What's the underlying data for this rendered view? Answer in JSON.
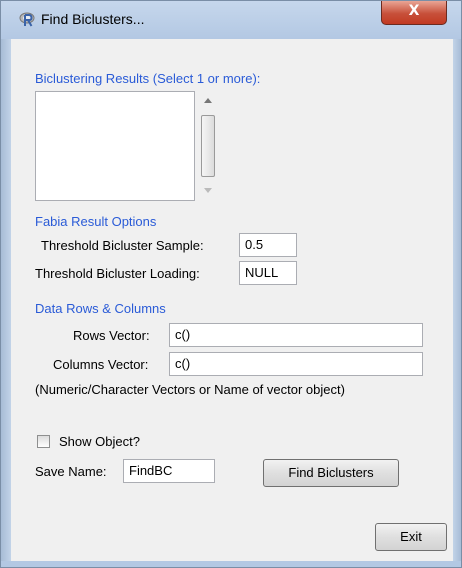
{
  "window": {
    "title": "Find Biclusters...",
    "close_label": "X"
  },
  "results": {
    "section_label": "Biclustering Results (Select 1 or more):",
    "items": []
  },
  "fabia": {
    "section_label": "Fabia Result Options",
    "thresh_sample_label": "Threshold Bicluster Sample:",
    "thresh_sample_value": "0.5",
    "thresh_loading_label": "Threshold Bicluster Loading:",
    "thresh_loading_value": "NULL"
  },
  "data": {
    "section_label": "Data Rows & Columns",
    "rows_label": "Rows Vector:",
    "rows_value": "c()",
    "cols_label": "Columns Vector:",
    "cols_value": "c()",
    "hint": "(Numeric/Character Vectors or Name of vector object)"
  },
  "options": {
    "show_object_label": "Show Object?",
    "show_object_checked": false,
    "save_name_label": "Save Name:",
    "save_name_value": "FindBC",
    "find_button": "Find Biclusters",
    "exit_button": "Exit"
  },
  "colors": {
    "section": "#2a5bd7",
    "close": "#c7503a"
  }
}
